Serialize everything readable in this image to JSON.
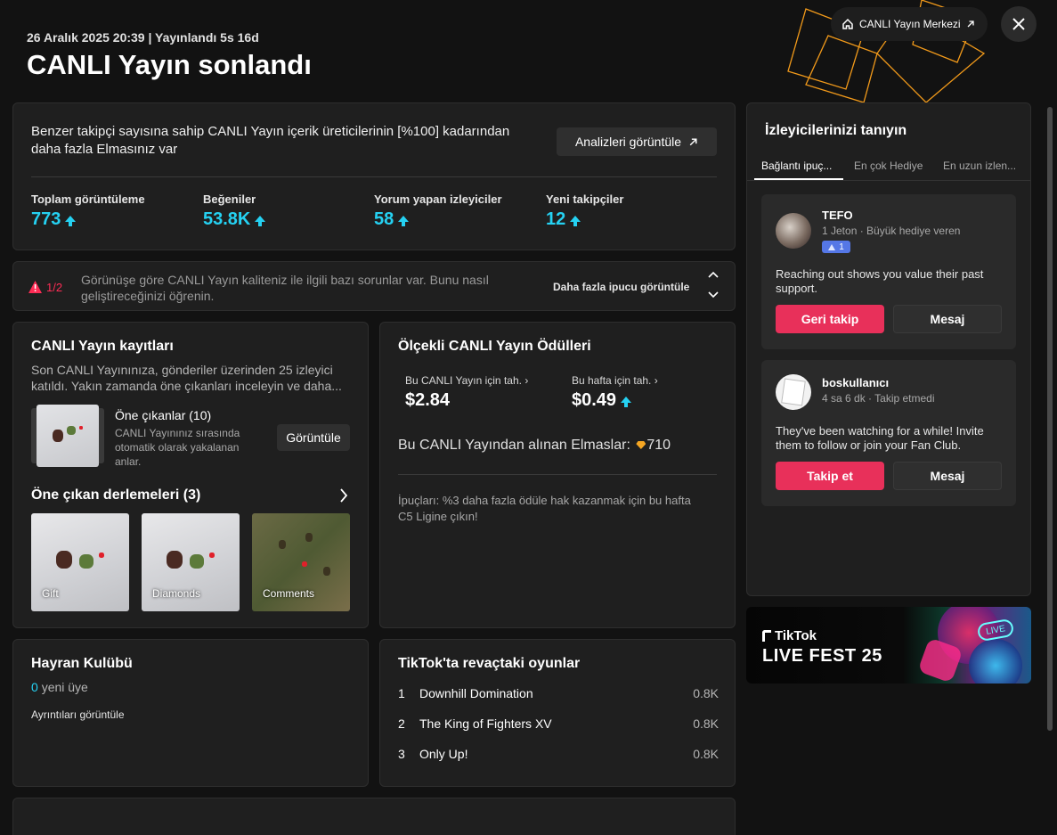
{
  "header": {
    "meta": "26 Aralık 2025 20:39 | Yayınlandı 5s 16d",
    "title": "CANLI Yayın sonlandı",
    "center_link": "CANLI Yayın Merkezi"
  },
  "summary": {
    "text": "Benzer takipçi sayısına sahip CANLI Yayın içerik üreticilerinin [%100] kadarından daha fazla Elmasınız var",
    "analytics_button": "Analizleri görüntüle",
    "stats": [
      {
        "label": "Toplam görüntüleme",
        "value": "773"
      },
      {
        "label": "Beğeniler",
        "value": "53.8K"
      },
      {
        "label": "Yorum yapan izleyiciler",
        "value": "58"
      },
      {
        "label": "Yeni takipçiler",
        "value": "12"
      }
    ]
  },
  "tip": {
    "counter": "1/2",
    "text": "Görünüşe göre CANLI Yayın kaliteniz ile ilgili bazı sorunlar var. Bunu nasıl geliştireceğinizi öğrenin.",
    "more": "Daha fazla ipucu görüntüle"
  },
  "recordings": {
    "title": "CANLI Yayın kayıtları",
    "desc": "Son CANLI Yayınınıza, gönderiler üzerinden 25 izleyici katıldı. Yakın zamanda öne çıkanları inceleyin ve daha...",
    "highlights_title": "Öne çıkanlar (10)",
    "highlights_desc": "CANLI Yayınınız sırasında otomatik olarak yakalanan anlar.",
    "view_button": "Görüntüle",
    "compilations_title": "Öne çıkan derlemeleri (3)",
    "compilations": [
      "Gift",
      "Diamonds",
      "Comments"
    ]
  },
  "rewards": {
    "title": "Ölçekli CANLI Yayın Ödülleri",
    "live_label": "Bu CANLI Yayın için tah.",
    "live_value": "$2.84",
    "week_label": "Bu hafta için tah.",
    "week_value": "$0.49",
    "diamonds_label": "Bu CANLI Yayından alınan Elmaslar:",
    "diamonds_value": "710",
    "tip": "İpuçları: %3 daha fazla ödüle hak kazanmak için bu hafta C5 Ligine çıkın!"
  },
  "fanclub": {
    "title": "Hayran Kulübü",
    "count": "0",
    "count_label": "yeni üye",
    "details": "Ayrıntıları görüntüle"
  },
  "games": {
    "title": "TikTok'ta revaçtaki oyunlar",
    "items": [
      {
        "rank": "1",
        "name": "Downhill Domination",
        "value": "0.8K"
      },
      {
        "rank": "2",
        "name": "The King of Fighters XV",
        "value": "0.8K"
      },
      {
        "rank": "3",
        "name": "Only Up!",
        "value": "0.8K"
      }
    ]
  },
  "viewers": {
    "title": "İzleyicilerinizi tanıyın",
    "tabs": [
      "Bağlantı ipuç...",
      "En çok Hediye",
      "En uzun izlen..."
    ],
    "cards": [
      {
        "name": "TEFO",
        "sub": "1 Jeton · Büyük hediye veren",
        "badge": "1",
        "message": "Reaching out shows you value their past support.",
        "primary": "Geri takip",
        "secondary": "Mesaj"
      },
      {
        "name": "boskullanıcı",
        "sub": "4 sa 6 dk · Takip etmedi",
        "message": "They've been watching for a while! Invite them to follow or join your Fan Club.",
        "primary": "Takip et",
        "secondary": "Mesaj"
      }
    ]
  },
  "banner": {
    "brand": "TikTok",
    "title": "LIVE FEST 25",
    "badge": "LIVE"
  },
  "colors": {
    "accent": "#25d1f2",
    "pink": "#e8305a",
    "warn": "#fe2c55",
    "gold": "#f5a623"
  }
}
